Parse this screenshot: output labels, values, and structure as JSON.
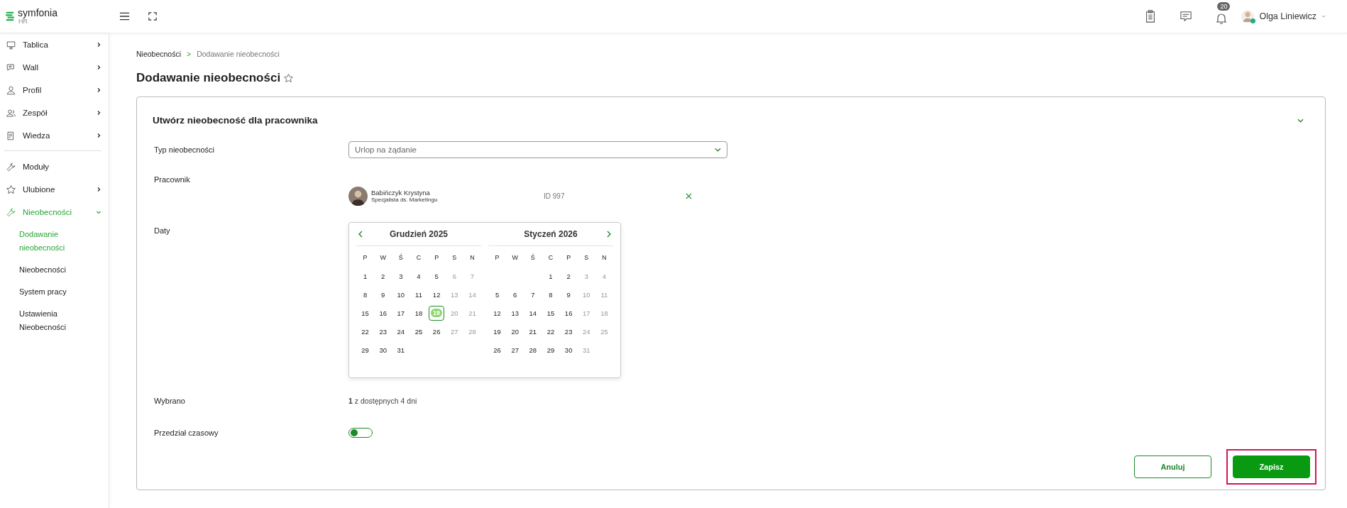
{
  "logo": {
    "name": "symfonia",
    "product": "HR"
  },
  "header": {
    "notifications": "20",
    "user": "Olga Liniewicz"
  },
  "sidebar": {
    "groups": [
      [
        {
          "label": "Tablica",
          "expandable": true,
          "expanded": false,
          "selected": false
        },
        {
          "label": "Wall",
          "expandable": true,
          "expanded": false,
          "selected": false
        },
        {
          "label": "Profil",
          "expandable": true,
          "expanded": false,
          "selected": false
        },
        {
          "label": "Zespół",
          "expandable": true,
          "expanded": false,
          "selected": false
        },
        {
          "label": "Wiedza",
          "expandable": true,
          "expanded": false,
          "selected": false
        }
      ],
      [
        {
          "label": "Moduły",
          "expandable": false,
          "selected": false
        },
        {
          "label": "Ulubione",
          "expandable": true,
          "expanded": false,
          "selected": false
        },
        {
          "label": "Nieobecności",
          "expandable": true,
          "expanded": true,
          "selected": true,
          "children": [
            {
              "label": "Dodawanie nieobecności",
              "selected": true
            },
            {
              "label": "Nieobecności",
              "selected": false
            },
            {
              "label": "System pracy",
              "selected": false
            },
            {
              "label": "Ustawienia Nieobecności",
              "selected": false
            }
          ]
        }
      ]
    ]
  },
  "breadcrumb": {
    "items": [
      "Nieobecności",
      "Dodawanie nieobecności"
    ],
    "separator": ">"
  },
  "page_title": "Dodawanie nieobecności",
  "favorite": false,
  "card": {
    "title": "Utwórz nieobecność dla pracownika",
    "expanded": true,
    "type_label": "Typ nieobecności",
    "type_value": "Urlop na żądanie",
    "employee_label": "Pracownik",
    "employee": {
      "name": "Babińczyk Krystyna",
      "role": "Specjalista ds. Marketingu",
      "id": "ID 997"
    },
    "dates_label": "Daty",
    "calendar": {
      "months": [
        {
          "title": "Grudzień 2025",
          "weekdays": [
            "P",
            "W",
            "Ś",
            "C",
            "P",
            "S",
            "N"
          ],
          "weeks": [
            [
              {
                "day": "1",
                "disabled": false,
                "selected": false
              },
              {
                "day": "2",
                "disabled": false,
                "selected": false
              },
              {
                "day": "3",
                "disabled": false,
                "selected": false
              },
              {
                "day": "4",
                "disabled": false,
                "selected": false
              },
              {
                "day": "5",
                "disabled": false,
                "selected": false
              },
              {
                "day": "6",
                "disabled": true,
                "selected": false
              },
              {
                "day": "7",
                "disabled": true,
                "selected": false
              }
            ],
            [
              {
                "day": "8",
                "disabled": false,
                "selected": false
              },
              {
                "day": "9",
                "disabled": false,
                "selected": false
              },
              {
                "day": "10",
                "disabled": false,
                "selected": false
              },
              {
                "day": "11",
                "disabled": false,
                "selected": false
              },
              {
                "day": "12",
                "disabled": false,
                "selected": false
              },
              {
                "day": "13",
                "disabled": true,
                "selected": false
              },
              {
                "day": "14",
                "disabled": true,
                "selected": false
              }
            ],
            [
              {
                "day": "15",
                "disabled": false,
                "selected": false
              },
              {
                "day": "16",
                "disabled": false,
                "selected": false
              },
              {
                "day": "17",
                "disabled": false,
                "selected": false
              },
              {
                "day": "18",
                "disabled": false,
                "selected": false
              },
              {
                "day": "19",
                "disabled": false,
                "selected": true
              },
              {
                "day": "20",
                "disabled": true,
                "selected": false
              },
              {
                "day": "21",
                "disabled": true,
                "selected": false
              }
            ],
            [
              {
                "day": "22",
                "disabled": false,
                "selected": false
              },
              {
                "day": "23",
                "disabled": false,
                "selected": false
              },
              {
                "day": "24",
                "disabled": false,
                "selected": false
              },
              {
                "day": "25",
                "disabled": false,
                "selected": false
              },
              {
                "day": "26",
                "disabled": false,
                "selected": false
              },
              {
                "day": "27",
                "disabled": true,
                "selected": false
              },
              {
                "day": "28",
                "disabled": true,
                "selected": false
              }
            ],
            [
              {
                "day": "29",
                "disabled": false,
                "selected": false
              },
              {
                "day": "30",
                "disabled": false,
                "selected": false
              },
              {
                "day": "31",
                "disabled": false,
                "selected": false
              }
            ]
          ]
        },
        {
          "title": "Styczeń 2026",
          "weekdays": [
            "P",
            "W",
            "Ś",
            "C",
            "P",
            "S",
            "N"
          ],
          "weeks": [
            [
              {
                "day": "1",
                "disabled": false,
                "selected": false
              },
              {
                "day": "2",
                "disabled": false,
                "selected": false
              },
              {
                "day": "3",
                "disabled": true,
                "selected": false
              },
              {
                "day": "4",
                "disabled": true,
                "selected": false
              }
            ],
            [
              {
                "day": "5",
                "disabled": false,
                "selected": false
              },
              {
                "day": "6",
                "disabled": false,
                "selected": false
              },
              {
                "day": "7",
                "disabled": false,
                "selected": false
              },
              {
                "day": "8",
                "disabled": false,
                "selected": false
              },
              {
                "day": "9",
                "disabled": false,
                "selected": false
              },
              {
                "day": "10",
                "disabled": true,
                "selected": false
              },
              {
                "day": "11",
                "disabled": true,
                "selected": false
              }
            ],
            [
              {
                "day": "12",
                "disabled": false,
                "selected": false
              },
              {
                "day": "13",
                "disabled": false,
                "selected": false
              },
              {
                "day": "14",
                "disabled": false,
                "selected": false
              },
              {
                "day": "15",
                "disabled": false,
                "selected": false
              },
              {
                "day": "16",
                "disabled": false,
                "selected": false
              },
              {
                "day": "17",
                "disabled": true,
                "selected": false
              },
              {
                "day": "18",
                "disabled": true,
                "selected": false
              }
            ],
            [
              {
                "day": "19",
                "disabled": false,
                "selected": false
              },
              {
                "day": "20",
                "disabled": false,
                "selected": false
              },
              {
                "day": "21",
                "disabled": false,
                "selected": false
              },
              {
                "day": "22",
                "disabled": false,
                "selected": false
              },
              {
                "day": "23",
                "disabled": false,
                "selected": false
              },
              {
                "day": "24",
                "disabled": true,
                "selected": false
              },
              {
                "day": "25",
                "disabled": true,
                "selected": false
              }
            ],
            [
              {
                "day": "26",
                "disabled": false,
                "selected": false
              },
              {
                "day": "27",
                "disabled": false,
                "selected": false
              },
              {
                "day": "28",
                "disabled": false,
                "selected": false
              },
              {
                "day": "29",
                "disabled": false,
                "selected": false
              },
              {
                "day": "30",
                "disabled": false,
                "selected": false
              },
              {
                "day": "31",
                "disabled": true,
                "selected": false
              }
            ]
          ]
        }
      ]
    },
    "selected_label": "Wybrano",
    "selected_value": "**1** z dostępnych 4 dni",
    "range_label": "Przedział czasowy",
    "range_toggle": {
      "on": false
    },
    "buttons": [
      {
        "label": "Anuluj",
        "kind": "secondary",
        "highlighted": false
      },
      {
        "label": "Zapisz",
        "kind": "primary",
        "highlighted": true
      }
    ]
  }
}
